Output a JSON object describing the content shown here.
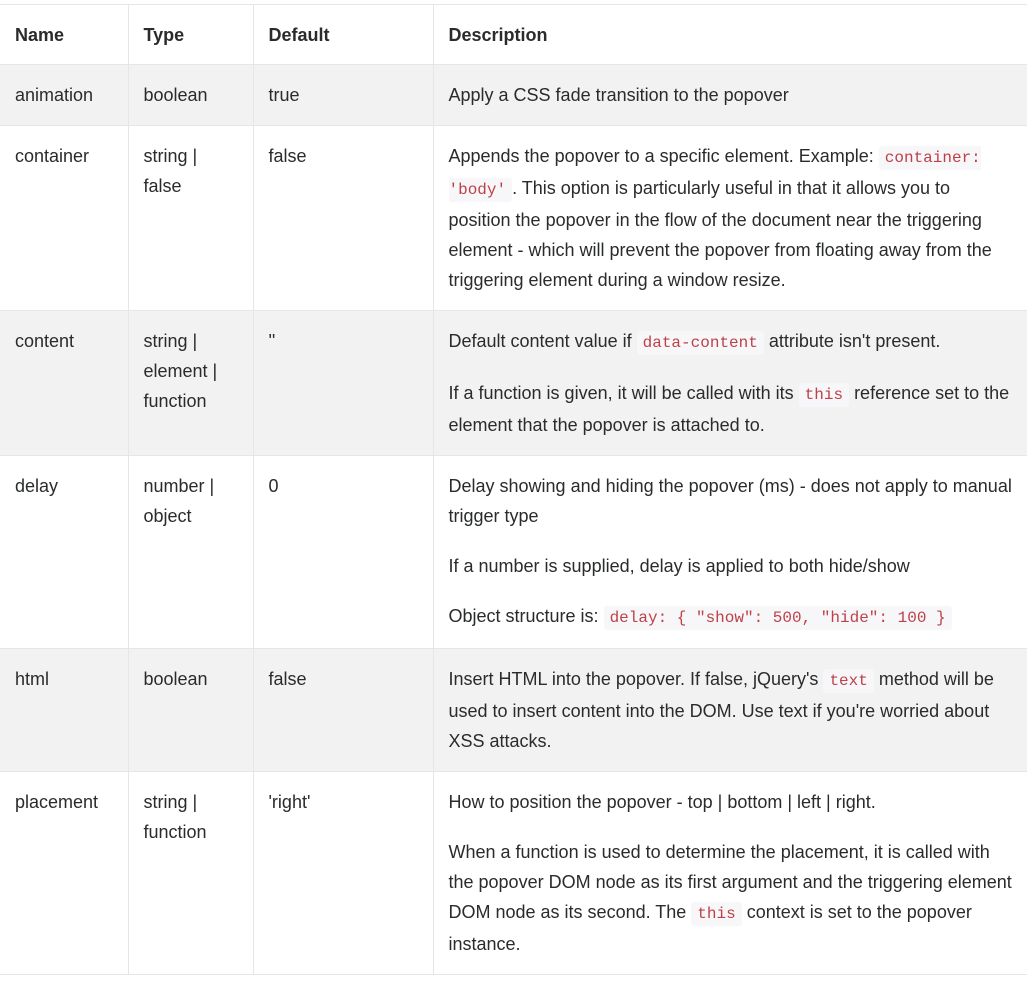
{
  "headers": [
    "Name",
    "Type",
    "Default",
    "Description"
  ],
  "rows": [
    {
      "name": "animation",
      "type": "boolean",
      "default": "true",
      "description": [
        [
          {
            "t": "Apply a CSS fade transition to the popover"
          }
        ]
      ]
    },
    {
      "name": "container",
      "type": "string | false",
      "default": "false",
      "description": [
        [
          {
            "t": "Appends the popover to a specific element. Example: "
          },
          {
            "c": "container: 'body'"
          },
          {
            "t": ". This option is particularly useful in that it allows you to position the popover in the flow of the document near the triggering element - which will prevent the popover from floating away from the triggering element during a window resize."
          }
        ]
      ]
    },
    {
      "name": "content",
      "type": "string | element | function",
      "default": "''",
      "description": [
        [
          {
            "t": "Default content value if "
          },
          {
            "c": "data-content"
          },
          {
            "t": " attribute isn't present."
          }
        ],
        [
          {
            "t": "If a function is given, it will be called with its "
          },
          {
            "c": "this"
          },
          {
            "t": " reference set to the element that the popover is attached to."
          }
        ]
      ]
    },
    {
      "name": "delay",
      "type": "number | object",
      "default": "0",
      "description": [
        [
          {
            "t": "Delay showing and hiding the popover (ms) - does not apply to manual trigger type"
          }
        ],
        [
          {
            "t": "If a number is supplied, delay is applied to both hide/show"
          }
        ],
        [
          {
            "t": "Object structure is: "
          },
          {
            "c": "delay: { \"show\": 500, \"hide\": 100 }"
          }
        ]
      ]
    },
    {
      "name": "html",
      "type": "boolean",
      "default": "false",
      "description": [
        [
          {
            "t": "Insert HTML into the popover. If false, jQuery's "
          },
          {
            "c": "text"
          },
          {
            "t": " method will be used to insert content into the DOM. Use text if you're worried about XSS attacks."
          }
        ]
      ]
    },
    {
      "name": "placement",
      "type": "string | function",
      "default": "'right'",
      "description": [
        [
          {
            "t": "How to position the popover - top | bottom | left | right."
          }
        ],
        [
          {
            "t": "When a function is used to determine the placement, it is called with the popover DOM node as its first argument and the triggering element DOM node as its second. The "
          },
          {
            "c": "this"
          },
          {
            "t": " context is set to the popover instance."
          }
        ]
      ]
    }
  ]
}
